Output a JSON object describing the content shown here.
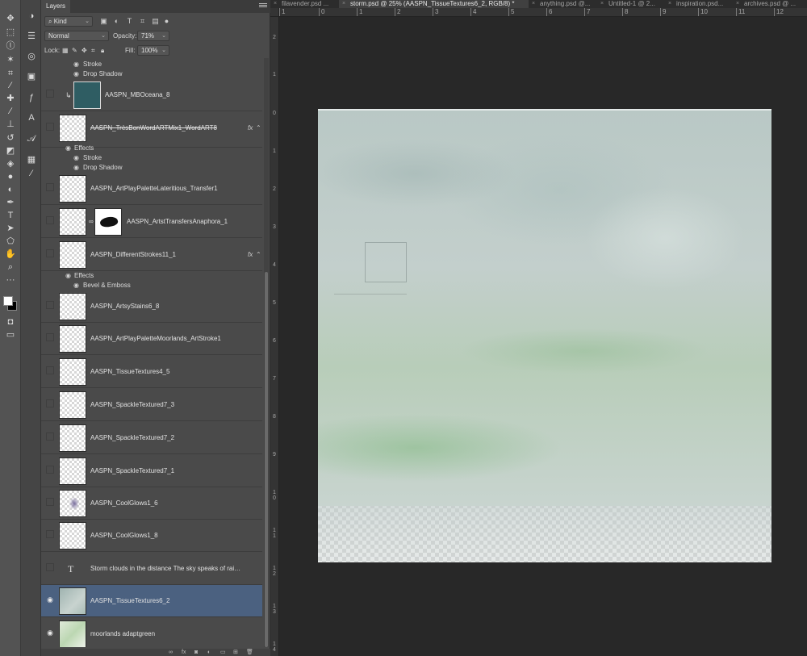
{
  "panel": {
    "tab_label": "Layers",
    "filter_kind": "Kind",
    "blend_mode": "Normal",
    "opacity_label": "Opacity:",
    "opacity_value": "71%",
    "lock_label": "Lock:",
    "fill_label": "Fill:",
    "fill_value": "100%"
  },
  "effects": {
    "stroke": "Stroke",
    "drop_shadow": "Drop Shadow",
    "effects": "Effects",
    "bevel_emboss": "Bevel & Emboss"
  },
  "layers": [
    {
      "name": "AASPN_MBOceana_8",
      "thumb": "ocean",
      "clipped": true
    },
    {
      "name": "AASPN_TrèsBonWordARTMix1_WordART8",
      "fx": "fx"
    },
    {
      "name": "AASPN_ArtPlayPaletteLateritious_Transfer1"
    },
    {
      "name": "AASPN_ArtstTransfersAnaphora_1",
      "masked": true
    },
    {
      "name": "AASPN_DifferentStrokes11_1",
      "fx": "fx"
    },
    {
      "name": "AASPN_ArtsyStains6_8"
    },
    {
      "name": "AASPN_ArtPlayPaletteMoorlands_ArtStroke1"
    },
    {
      "name": "AASPN_TissueTextures4_5"
    },
    {
      "name": "AASPN_SpackleTextured7_3"
    },
    {
      "name": "AASPN_SpackleTextured7_2"
    },
    {
      "name": "AASPN_SpackleTextured7_1"
    },
    {
      "name": "AASPN_CoolGlows1_6",
      "thumb": "glow"
    },
    {
      "name": "AASPN_CoolGlows1_8"
    },
    {
      "name": "Storm clouds in the distance The sky speaks of rain The...",
      "type": "text"
    },
    {
      "name": "AASPN_TissueTextures6_2",
      "thumb": "texture",
      "visible": true,
      "selected": true
    },
    {
      "name": "moorlands adaptgreen",
      "thumb": "moorlands",
      "visible": true
    }
  ],
  "doc_tabs": [
    {
      "title": "filavender.psd ..."
    },
    {
      "title": "storm.psd @ 25% (AASPN_TissueTextures6_2, RGB/8) *",
      "active": true
    },
    {
      "title": "anything.psd @..."
    },
    {
      "title": "Untitled-1 @ 2..."
    },
    {
      "title": "inspiration.psd..."
    },
    {
      "title": "archives.psd @ ..."
    }
  ],
  "ruler_top": [
    "1",
    "0",
    "1",
    "2",
    "3",
    "4",
    "5",
    "6",
    "7",
    "8",
    "9",
    "10",
    "11",
    "12"
  ],
  "ruler_left": [
    "2",
    "1",
    "0",
    "1",
    "2",
    "3",
    "4",
    "5",
    "6",
    "7",
    "8",
    "9",
    "10",
    "11",
    "12",
    "13",
    "14"
  ],
  "icons": {
    "toolbar": [
      "move-icon",
      "marquee-icon",
      "lasso-icon",
      "magic-wand-icon",
      "crop-icon",
      "eyedropper-icon",
      "healing-brush-icon",
      "brush-icon",
      "clone-stamp-icon",
      "history-brush-icon",
      "eraser-icon",
      "paint-bucket-icon",
      "blur-icon",
      "dodge-icon",
      "pen-icon",
      "type-icon",
      "path-selection-icon",
      "shape-icon",
      "hand-icon",
      "zoom-icon",
      "more-tools-icon"
    ],
    "sidestrip": [
      "color-icon",
      "adjustments-icon",
      "swatches-icon",
      "properties-icon",
      "styles-icon",
      "character-icon",
      "glyphs-icon",
      "grid-icon",
      "brush-settings-icon"
    ]
  },
  "colors": {
    "selected_layer": "#4b6180",
    "panel_bg": "#4a4a4a",
    "canvas_bg": "#282828",
    "foreground_swatch": "#ffffff",
    "background_swatch": "#000000"
  }
}
